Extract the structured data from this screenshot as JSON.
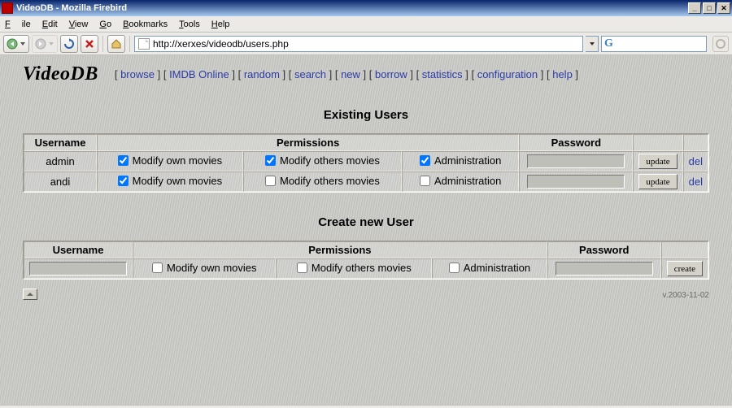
{
  "window": {
    "title": "VideoDB - Mozilla Firebird"
  },
  "menus": {
    "file": "File",
    "edit": "Edit",
    "view": "View",
    "go": "Go",
    "bookmarks": "Bookmarks",
    "tools": "Tools",
    "help": "Help"
  },
  "url": "http://xerxes/videodb/users.php",
  "searchGlyph": "G",
  "logo": "VideoDB",
  "nav": {
    "browse": "browse",
    "imdb": "IMDB Online",
    "random": "random",
    "search": "search",
    "new": "new",
    "borrow": "borrow",
    "statistics": "statistics",
    "configuration": "configuration",
    "help": "help"
  },
  "sections": {
    "existing": "Existing Users",
    "create": "Create new User"
  },
  "headers": {
    "username": "Username",
    "permissions": "Permissions",
    "password": "Password"
  },
  "permLabels": {
    "own": "Modify own movies",
    "others": "Modify others movies",
    "admin": "Administration"
  },
  "buttons": {
    "update": "update",
    "del": "del",
    "create": "create"
  },
  "users": [
    {
      "name": "admin",
      "own": true,
      "others": true,
      "admin": true
    },
    {
      "name": "andi",
      "own": true,
      "others": false,
      "admin": false
    }
  ],
  "newUser": {
    "own": false,
    "others": false,
    "admin": false
  },
  "version": "v.2003-11-02"
}
